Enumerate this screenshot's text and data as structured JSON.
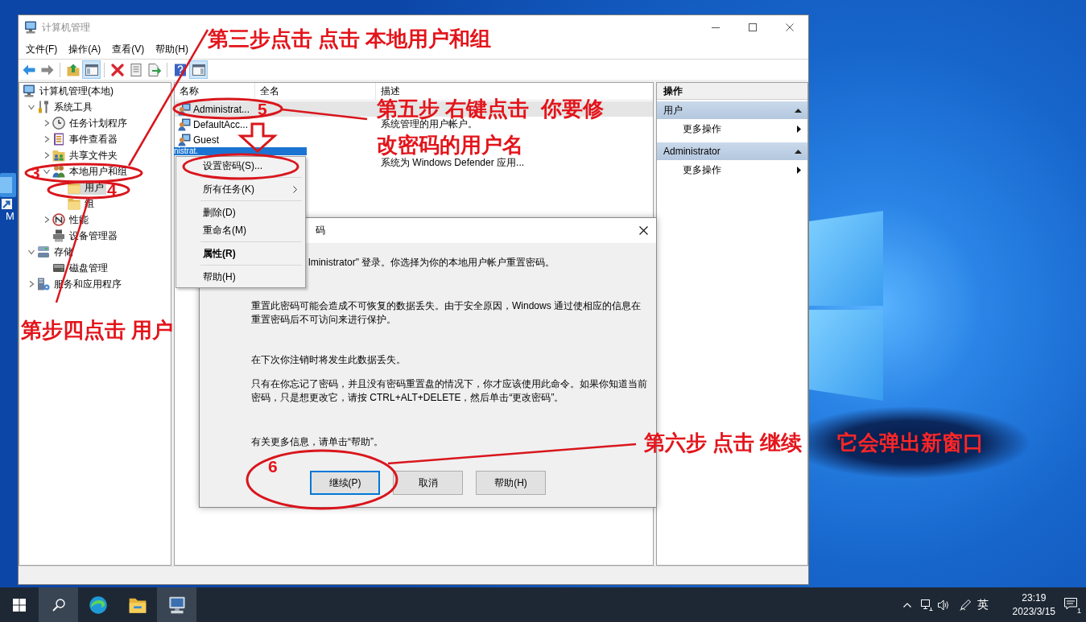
{
  "desktop": {
    "shortcut_label": "M"
  },
  "window": {
    "title": "计算机管理",
    "active": false
  },
  "menu": [
    "文件(F)",
    "操作(A)",
    "查看(V)",
    "帮助(H)"
  ],
  "toolbar": [
    {
      "kind": "back",
      "pressed": false
    },
    {
      "kind": "forward",
      "pressed": false
    },
    {
      "kind": "separator"
    },
    {
      "kind": "up",
      "pressed": false
    },
    {
      "kind": "console-tree",
      "pressed": true
    },
    {
      "kind": "separator"
    },
    {
      "kind": "delete",
      "pressed": false
    },
    {
      "kind": "properties",
      "pressed": false
    },
    {
      "kind": "export",
      "pressed": false
    },
    {
      "kind": "separator"
    },
    {
      "kind": "help",
      "pressed": false
    },
    {
      "kind": "action-pane",
      "pressed": true
    }
  ],
  "tree": [
    {
      "label": "计算机管理(本地)",
      "kind": "computer",
      "selected": false,
      "children": [
        {
          "label": "系统工具",
          "kind": "tools",
          "selected": false,
          "expanded": true,
          "children": [
            {
              "label": "任务计划程序",
              "kind": "clock",
              "selected": false,
              "expanded": false
            },
            {
              "label": "事件查看器",
              "kind": "log",
              "selected": false,
              "expanded": false
            },
            {
              "label": "共享文件夹",
              "kind": "share",
              "selected": false,
              "expanded": false
            },
            {
              "label": "本地用户和组",
              "kind": "users",
              "selected": false,
              "expanded": true,
              "children": [
                {
                  "label": "用户",
                  "kind": "folder",
                  "selected": true
                },
                {
                  "label": "组",
                  "kind": "folder",
                  "selected": false
                }
              ]
            },
            {
              "label": "性能",
              "kind": "performance",
              "selected": false,
              "expanded": false
            },
            {
              "label": "设备管理器",
              "kind": "devices",
              "selected": false
            }
          ]
        },
        {
          "label": "存储",
          "kind": "storage",
          "selected": false,
          "expanded": true,
          "children": [
            {
              "label": "磁盘管理",
              "kind": "disk",
              "selected": false
            }
          ]
        },
        {
          "label": "服务和应用程序",
          "kind": "services",
          "selected": false,
          "expanded": false
        }
      ]
    }
  ],
  "list": {
    "columns": [
      "名称",
      "全名",
      "描述"
    ],
    "rows": [
      {
        "kind": "row",
        "name": "Administrat...",
        "selected": true
      },
      {
        "kind": "row",
        "name": "DefaultAcc...",
        "description": "系统管理的用户帐户。",
        "selected": false
      },
      {
        "kind": "row",
        "name": "Guest",
        "selected": false
      },
      {
        "kind": "ghost",
        "label": "nistrat."
      },
      {
        "kind": "row",
        "description": "系统为 Windows Defender 应用...",
        "selected": false
      }
    ]
  },
  "context_menu": [
    {
      "kind": "item",
      "label": "设置密码(S)..."
    },
    {
      "kind": "separator"
    },
    {
      "kind": "submenu",
      "label": "所有任务(K)"
    },
    {
      "kind": "separator"
    },
    {
      "kind": "item",
      "label": "删除(D)"
    },
    {
      "kind": "item",
      "label": "重命名(M)"
    },
    {
      "kind": "separator"
    },
    {
      "kind": "default",
      "label": "属性(R)"
    },
    {
      "kind": "separator"
    },
    {
      "kind": "item",
      "label": "帮助(H)"
    }
  ],
  "actions": {
    "title": "操作",
    "sections": [
      {
        "title": "用户",
        "expanded": true,
        "items": [
          {
            "label": "更多操作",
            "kind": "submenu"
          }
        ]
      },
      {
        "title": "Administrator",
        "expanded": true,
        "items": [
          {
            "label": "更多操作",
            "kind": "submenu"
          }
        ]
      }
    ]
  },
  "dialog": {
    "title": "码",
    "intro": "lministrator\" 登录。你选择为你的本地用户帐户重置密码。",
    "paragraphs": [
      "重置此密码可能会造成不可恢复的数据丢失。由于安全原因，Windows 通过使相应的信息在重置密码后不可访问来进行保护。",
      "在下次你注销时将发生此数据丢失。",
      "只有在你忘记了密码，并且没有密码重置盘的情况下，你才应该使用此命令。如果你知道当前密码，只是想更改它，请按 CTRL+ALT+DELETE，然后单击“更改密码”。",
      "有关更多信息，请单击“帮助”。"
    ],
    "buttons": [
      {
        "label": "继续(P)",
        "default": true
      },
      {
        "label": "取消",
        "default": false
      },
      {
        "label": "帮助(H)",
        "default": false
      }
    ]
  },
  "taskbar": {
    "buttons": [
      {
        "kind": "start",
        "active": false
      },
      {
        "kind": "search",
        "active": true
      },
      {
        "kind": "browser",
        "active": false
      },
      {
        "kind": "folder",
        "active": false
      },
      {
        "kind": "computer",
        "active": true
      }
    ],
    "tray": {
      "ime": "英",
      "time": "23:19",
      "date": "2023/3/15",
      "notification_count": "1"
    }
  },
  "annotations": [
    {
      "kind": "caption",
      "text": "第三步点击 点击 本地用户和组"
    },
    {
      "kind": "number",
      "text": "3"
    },
    {
      "kind": "number",
      "text": "4"
    },
    {
      "kind": "caption",
      "text": "第步四点击 用户"
    },
    {
      "kind": "number",
      "text": "5"
    },
    {
      "kind": "caption",
      "text": "第五步 右键点击  你要修"
    },
    {
      "kind": "caption",
      "text": "改密码的用户名"
    },
    {
      "kind": "number",
      "text": "6"
    },
    {
      "kind": "caption",
      "text": "第六步 点击 继续"
    },
    {
      "kind": "caption",
      "text": "它会弹出新窗口"
    }
  ]
}
